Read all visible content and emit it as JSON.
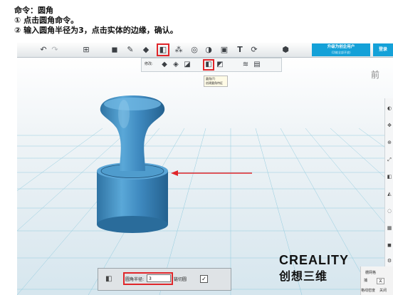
{
  "doc": {
    "title": "命令：圆角",
    "step1": "① 点击圆角命令。",
    "step2": "② 输入圆角半径为3，点击实体的边缘，确认。"
  },
  "toolbar": {
    "icons": [
      "undo-icon",
      "redo-icon",
      "add-icon",
      "cube-icon",
      "brush-icon",
      "fill-icon",
      "fillet-icon",
      "pattern-icon",
      "measure-icon",
      "surface-icon",
      "box-icon",
      "text-icon",
      "rotate-icon",
      "material-icon"
    ],
    "upgrade_line1": "升级为创企用户",
    "upgrade_line2": "(功能全部开放)",
    "login": "登录"
  },
  "subtoolbar": {
    "label": "修改:",
    "tooltip_title": "圆角(F)",
    "tooltip_desc": "创建圆角特征"
  },
  "viewcube": "前",
  "bottom_panel": {
    "radius_label": "圆角半径:",
    "radius_value": "3",
    "chain_label": "链切圆",
    "check_mark": "✓"
  },
  "logo": {
    "top": "CREALITY",
    "bottom": "创想三维"
  },
  "corner": {
    "a": "栅网格",
    "b": "关",
    "c": "捕",
    "d": "格线密度",
    "e": "关闭"
  },
  "colors": {
    "highlight": "#e0262a",
    "accent": "#14a1d8",
    "model": "#3e8fc4"
  }
}
